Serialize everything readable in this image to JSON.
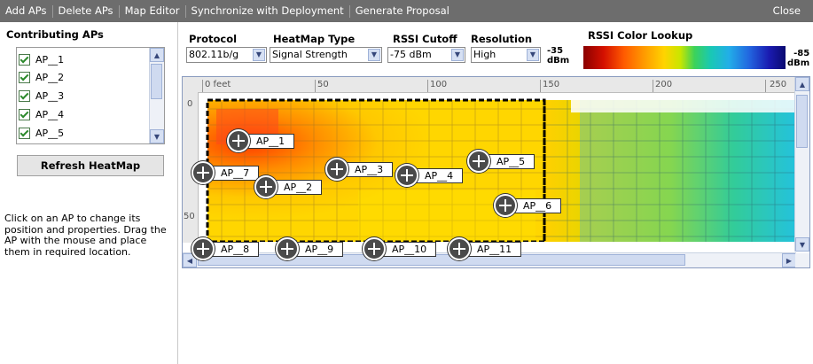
{
  "menu": {
    "items": [
      "Add APs",
      "Delete APs",
      "Map Editor",
      "Synchronize with Deployment",
      "Generate Proposal"
    ],
    "close": "Close"
  },
  "left": {
    "title": "Contributing APs",
    "aps": [
      {
        "label": "AP__1",
        "checked": true
      },
      {
        "label": "AP__2",
        "checked": true
      },
      {
        "label": "AP__3",
        "checked": true
      },
      {
        "label": "AP__4",
        "checked": true
      },
      {
        "label": "AP__5",
        "checked": true
      }
    ],
    "refresh_label": "Refresh HeatMap",
    "help_text": "Click on an AP to change its position and properties. Drag the AP with the mouse and place them in required location."
  },
  "toolbar": {
    "protocol": {
      "label": "Protocol",
      "value": "802.11b/g"
    },
    "heatmap_type": {
      "label": "HeatMap Type",
      "value": "Signal Strength"
    },
    "rssi_cutoff": {
      "label": "RSSI Cutoff",
      "value": "-75 dBm"
    },
    "resolution": {
      "label": "Resolution",
      "value": "High"
    },
    "color_lookup": {
      "label": "RSSI Color Lookup",
      "min": "-35",
      "max": "-85",
      "unit": "dBm"
    }
  },
  "map": {
    "ruler_x": [
      "0 feet",
      "50",
      "100",
      "150",
      "200",
      "250"
    ],
    "ruler_y": [
      "0",
      "50"
    ],
    "aps": [
      "AP__1",
      "AP__2",
      "AP__3",
      "AP__4",
      "AP__5",
      "AP__6",
      "AP__7",
      "AP__8",
      "AP__9",
      "AP__10",
      "AP__11"
    ]
  },
  "colors": {
    "menubar": "#6d6d6d",
    "scroll": "#d6e0f3"
  }
}
